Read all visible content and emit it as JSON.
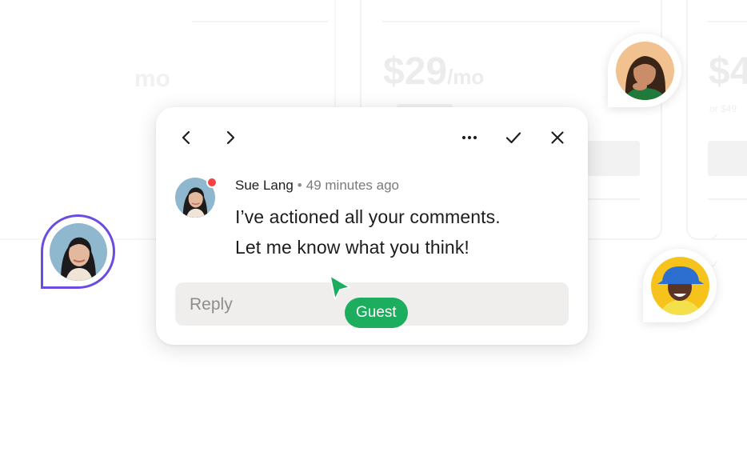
{
  "background": {
    "plan_1_price": "$29",
    "plan_1_unit": "/mo",
    "plan_0_unit": "mo",
    "plan_2_price": "$4",
    "plan_2_sub": "or $49"
  },
  "comment": {
    "author": "Sue Lang",
    "separator": "•",
    "time": "49 minutes ago",
    "lines": [
      "I’ve actioned all your comments.",
      "Let me know what you think!"
    ],
    "reply_placeholder": "Reply"
  },
  "cursor": {
    "label": "Guest",
    "color": "#1cad5e"
  },
  "colors": {
    "accent_purple": "#6b4ce0",
    "status_red": "#f14343"
  },
  "icons": {
    "prev": "chevron-left-icon",
    "next": "chevron-right-icon",
    "more": "more-horizontal-icon",
    "resolve": "check-icon",
    "close": "close-icon"
  }
}
